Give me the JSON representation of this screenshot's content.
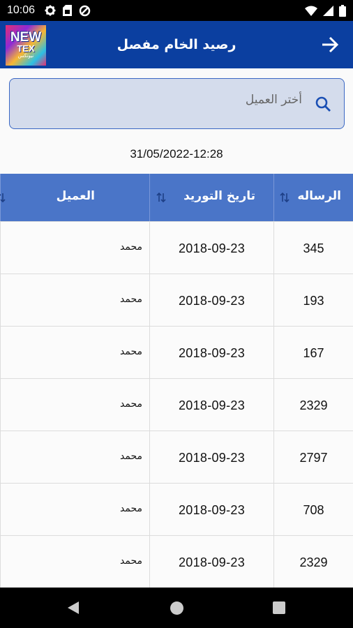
{
  "status_bar": {
    "time": "10:06",
    "icons_left": [
      "settings-icon",
      "sim-card-icon",
      "data-saver-icon"
    ],
    "icons_right": [
      "wifi-icon",
      "cellular-signal-icon",
      "battery-icon"
    ]
  },
  "app_bar": {
    "title": "رصيد الخام مفصل",
    "logo": {
      "line1": "NEW",
      "line2": "TEX",
      "line3": "نيوتكس"
    },
    "back_icon": "arrow-right-icon"
  },
  "search": {
    "placeholder": "أختر العميل",
    "icon": "search-icon"
  },
  "timestamp": "31/05/2022-12:28",
  "table": {
    "headers": {
      "client": "العميل",
      "supply_date": "تاريخ التوريد",
      "message": "الرساله"
    },
    "rows": [
      {
        "client": "محمد",
        "supply_date": "2018-09-23",
        "message": "345"
      },
      {
        "client": "محمد",
        "supply_date": "2018-09-23",
        "message": "193"
      },
      {
        "client": "محمد",
        "supply_date": "2018-09-23",
        "message": "167"
      },
      {
        "client": "محمد",
        "supply_date": "2018-09-23",
        "message": "2329"
      },
      {
        "client": "محمد",
        "supply_date": "2018-09-23",
        "message": "2797"
      },
      {
        "client": "محمد",
        "supply_date": "2018-09-23",
        "message": "708"
      },
      {
        "client": "محمد",
        "supply_date": "2018-09-23",
        "message": "2329"
      }
    ]
  },
  "colors": {
    "app_bar": "#0b3fa0",
    "table_header": "#4a75c8",
    "search_bg": "#d4dcec",
    "search_border": "#3a67c4"
  }
}
